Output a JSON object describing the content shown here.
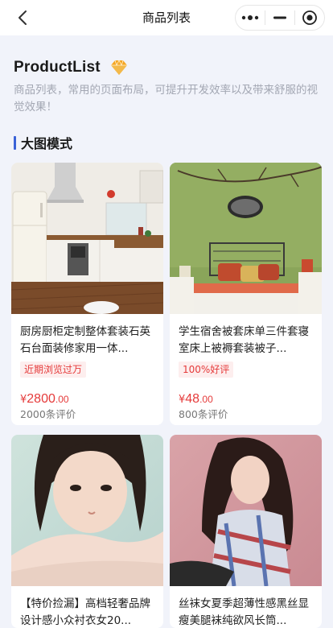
{
  "navbar": {
    "title": "商品列表",
    "back_icon": "chevron-left-icon",
    "more_icon": "more-dots-icon",
    "minimize_icon": "minimize-icon",
    "close_icon": "target-circle-icon"
  },
  "intro": {
    "title": "ProductList",
    "badge_icon": "diamond-icon",
    "description": "商品列表，常用的页面布局，可提升开发效率以及带来舒服的视觉效果！"
  },
  "section": {
    "title": "大图模式",
    "accent": "#3a62d7"
  },
  "colors": {
    "price": "#e53a3a",
    "tag_bg": "#fdeeee",
    "page_bg": "#f1f3fa"
  },
  "products": [
    {
      "name": "厨房厨柜定制整体套装石英石台面装修家用一体...",
      "tag": "近期浏览过万",
      "price_symbol": "¥",
      "price_int": "2800",
      "price_dec": ".00",
      "reviews": "2000条评价",
      "image": "kitchen-photo"
    },
    {
      "name": "学生宿舍被套床单三件套寝室床上被褥套装被子...",
      "tag": "100%好评",
      "price_symbol": "¥",
      "price_int": "48",
      "price_dec": ".00",
      "reviews": "800条评价",
      "image": "bedroom-photo"
    },
    {
      "name": "【特价捡漏】高档轻奢品牌设计感小众衬衣女20...",
      "image": "portrait-photo"
    },
    {
      "name": "丝袜女夏季超薄性感黑丝显瘦美腿袜纯欲风长筒...",
      "image": "model-photo"
    }
  ]
}
